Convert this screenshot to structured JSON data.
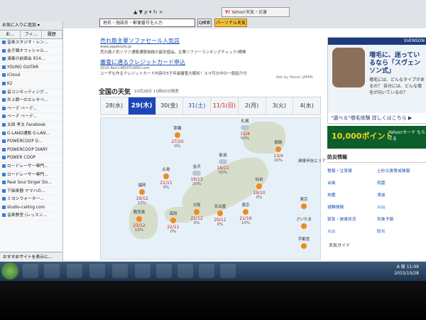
{
  "browser": {
    "tab_title": "Yahoo!天気・災害",
    "tab_logo": "Y!",
    "search_placeholder": "地名・施設名・郵便番号を入力",
    "search_button": "Q検索",
    "search_button2": "パーソナル天気",
    "icons_hint": "▲ ▼ ρ ▾ ↻ ×"
  },
  "sidebar": {
    "header": "お気に入りに追加 ▾",
    "tabs": [
      "お...",
      "フィ...",
      "履歴"
    ],
    "items": [
      "音楽スタジオ・レン...",
      "金子親オフィシャル...",
      "演奏の前面会 814...",
      "YOUNG GUITAR",
      "iCloud",
      "K2",
      "音コンセッティング...",
      "井上節一のエレキベ...",
      "ベーデ ベーデ...",
      "ベーデ ベーデ...",
      "太田 孝太 Facebook",
      "G-LAND通販 G-LAN...",
      "POWERCOOP D...",
      "POWERCOOP DIARY",
      "POWER COOP",
      "ロードレーサー専門...",
      "ロードレーサー専門...",
      "Real Soul Singer Do...",
      "下価楽器 ヤマハの...",
      "ミヨシウォーター...",
      "studio-calling.com",
      "音楽教室 (レッスン..."
    ],
    "footer": "おすすめサイトを表示に..."
  },
  "ads": {
    "ad1_title": "売れ筋主華ソファセール人気店",
    "ad1_url": "www.applesofa.jp",
    "ad1_desc": "売れ筋人気ソファ通販通販価格の最安値品。主華ソファーランキングチェック!横棒",
    "ad2_title": "審査に通るクレジットカード申込",
    "ad2_url": "2015.fbcf.CREDITCARD.com",
    "ad2_desc": "ユーザも作るクレジットカード内容の5千年最審査大解析！スマ可分中の一般紹介付",
    "ads_by": "Ads by Yahoo! JAPAN"
  },
  "weather": {
    "title": "全国の天気",
    "time": "10月28日 11時00分発表",
    "days": [
      {
        "label": "28(水)",
        "cls": ""
      },
      {
        "label": "29(木)",
        "cls": "sel"
      },
      {
        "label": "30(金)",
        "cls": ""
      },
      {
        "label": "31(土)",
        "cls": "sat"
      },
      {
        "label": "11/1(日)",
        "cls": "sun"
      },
      {
        "label": "2(月)",
        "cls": ""
      },
      {
        "label": "3(火)",
        "cls": ""
      },
      {
        "label": "4(水)",
        "cls": ""
      }
    ],
    "cities": [
      {
        "name": "那覇",
        "temp": "27/20",
        "pop": "0%",
        "icon": "sun"
      },
      {
        "name": "札幌",
        "temp": "11/4",
        "pop": "50%",
        "icon": "cloud"
      },
      {
        "name": "釧路",
        "temp": "13/4",
        "pop": "20%",
        "icon": "sun"
      },
      {
        "name": "広島",
        "temp": "21/11",
        "pop": "0%",
        "icon": "sun"
      },
      {
        "name": "金沢",
        "temp": "18/13",
        "pop": "20%",
        "icon": "cloud"
      },
      {
        "name": "新潟",
        "temp": "18/11",
        "pop": "50%",
        "icon": "cloud"
      },
      {
        "name": "福岡",
        "temp": "19/12",
        "pop": "10%",
        "icon": "sun"
      },
      {
        "name": "大阪",
        "temp": "21/12",
        "pop": "0%",
        "icon": "sun"
      },
      {
        "name": "仙台",
        "temp": "19/10",
        "pop": "0%",
        "icon": "sun"
      },
      {
        "name": "鹿児島",
        "temp": "23/12",
        "pop": "10%",
        "icon": "sun"
      },
      {
        "name": "高知",
        "temp": "22/11",
        "pop": "0%",
        "icon": "sun"
      },
      {
        "name": "名古屋",
        "temp": "20/11",
        "pop": "0%",
        "icon": "sun"
      },
      {
        "name": "東京",
        "temp": "21/16",
        "pop": "10%",
        "icon": "sun"
      }
    ],
    "side_cities": [
      "東京",
      "さいたま",
      "宇都宮"
    ],
    "side_title": "関東甲信エリア"
  },
  "right": {
    "banner_head": "SVENSON",
    "banner_text": "増毛に、迷っているなら「スヴェンソン式」",
    "banner_sub": "増毛には、どんなタイプがあるの？ 自分には、どんな増毛が向いているの？",
    "banner_footer": "\"選べる\"増毛体験  詳しくはこちら ▶",
    "banner2_text": "10,000ポイント",
    "banner2_sub": "Yahoo!カード もらえる",
    "disaster_title": "防災情報",
    "disaster_links": [
      "警報・注意報",
      "土砂災害警戒情報",
      "台風",
      "雨雲",
      "地震",
      "津波",
      "避難情報",
      "火山",
      "緊急・被害状況",
      "気象予報",
      "火山",
      "防災"
    ],
    "guide": "天気ガイド"
  },
  "taskbar": {
    "time": "11:09",
    "date": "2015/10/28",
    "tray_lang": "A 般"
  }
}
